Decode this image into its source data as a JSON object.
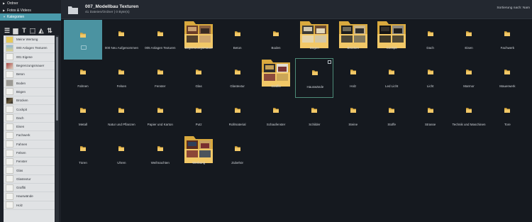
{
  "sidebar": {
    "sections": [
      {
        "label": "Ordner",
        "active": false
      },
      {
        "label": "Fotos & Videos",
        "active": false
      },
      {
        "label": "Kategorien",
        "active": true
      }
    ],
    "toolbar_icons": [
      "menu-icon",
      "new-folder-icon",
      "text-icon",
      "tag-icon",
      "paint-icon",
      "sort-icon"
    ],
    "categories": [
      {
        "label": "Meine Wertung",
        "thumb": "star"
      },
      {
        "label": "000 Anlagen Texturen",
        "thumb": "sky"
      },
      {
        "label": "001 Eigene",
        "thumb": "plain"
      },
      {
        "label": "Begrenzungsmauer",
        "thumb": "red"
      },
      {
        "label": "Beton",
        "thumb": "plain"
      },
      {
        "label": "Boden",
        "thumb": "gray"
      },
      {
        "label": "Bögen",
        "thumb": "plain"
      },
      {
        "label": "Brücken",
        "thumb": "dark"
      },
      {
        "label": "Cockpit",
        "thumb": "plain"
      },
      {
        "label": "Dach",
        "thumb": "plain"
      },
      {
        "label": "Eisen",
        "thumb": "plain"
      },
      {
        "label": "Fachwerk",
        "thumb": "plain"
      },
      {
        "label": "Fahnen",
        "thumb": "plain"
      },
      {
        "label": "Felsen",
        "thumb": "plain"
      },
      {
        "label": "Fenster",
        "thumb": "plain"
      },
      {
        "label": "Glas",
        "thumb": "plain"
      },
      {
        "label": "Glastextur",
        "thumb": "plain"
      },
      {
        "label": "Graffiti",
        "thumb": "plain"
      },
      {
        "label": "Hauswände",
        "thumb": "plain"
      },
      {
        "label": "Holz",
        "thumb": "plain"
      }
    ]
  },
  "header": {
    "title": "007_Modellbau Texturen",
    "subtitle": "41 Dateien/Ordner | 0 Byte(s)",
    "sort_label": "Sortierung nach: Nam"
  },
  "items": [
    {
      "label": "",
      "kind": "selected"
    },
    {
      "label": "000 Neu Aufgenommen",
      "kind": "small"
    },
    {
      "label": "005 Anlagen Texturen",
      "kind": "small"
    },
    {
      "label": "Begrenzungsmauer",
      "kind": "big",
      "photo": "wall"
    },
    {
      "label": "Beton",
      "kind": "small"
    },
    {
      "label": "Boden",
      "kind": "small"
    },
    {
      "label": "Bögen",
      "kind": "big",
      "photo": "arch"
    },
    {
      "label": "Brücken",
      "kind": "big",
      "photo": "bridge"
    },
    {
      "label": "Cockpit",
      "kind": "big",
      "photo": "cockpit"
    },
    {
      "label": "Dach",
      "kind": "small"
    },
    {
      "label": "Eisen",
      "kind": "small"
    },
    {
      "label": "Fachwerk",
      "kind": "small"
    },
    {
      "label": "Fahnen",
      "kind": "small"
    },
    {
      "label": "Felsen",
      "kind": "small"
    },
    {
      "label": "Fenster",
      "kind": "small"
    },
    {
      "label": "Glas",
      "kind": "small"
    },
    {
      "label": "Glastextur",
      "kind": "small"
    },
    {
      "label": "Graffiti",
      "kind": "big",
      "photo": "graffiti"
    },
    {
      "label": "Hauswände",
      "kind": "hover"
    },
    {
      "label": "Holz",
      "kind": "small"
    },
    {
      "label": "Led Licht",
      "kind": "small"
    },
    {
      "label": "Licht",
      "kind": "small"
    },
    {
      "label": "Marmor",
      "kind": "small"
    },
    {
      "label": "Mauerwerk",
      "kind": "small"
    },
    {
      "label": "Metall",
      "kind": "small"
    },
    {
      "label": "Natur und Pflanzen",
      "kind": "small"
    },
    {
      "label": "Papier und Karton",
      "kind": "small"
    },
    {
      "label": "Putz",
      "kind": "small"
    },
    {
      "label": "Rollmaterial",
      "kind": "small"
    },
    {
      "label": "Schaufenster",
      "kind": "small"
    },
    {
      "label": "Schilder",
      "kind": "small"
    },
    {
      "label": "Steine",
      "kind": "small"
    },
    {
      "label": "Stoffe",
      "kind": "small"
    },
    {
      "label": "Strasse",
      "kind": "small"
    },
    {
      "label": "Technik und Maschinen",
      "kind": "small"
    },
    {
      "label": "Tore",
      "kind": "small"
    },
    {
      "label": "Türen",
      "kind": "small"
    },
    {
      "label": "Uhren",
      "kind": "small"
    },
    {
      "label": "Weihnachten",
      "kind": "small"
    },
    {
      "label": "Werbung",
      "kind": "big",
      "photo": "ads"
    },
    {
      "label": "Zubehör",
      "kind": "small"
    }
  ],
  "colors": {
    "folder": "#f2c867",
    "folder_dark": "#d9a93e",
    "selected": "#4b93a1"
  }
}
